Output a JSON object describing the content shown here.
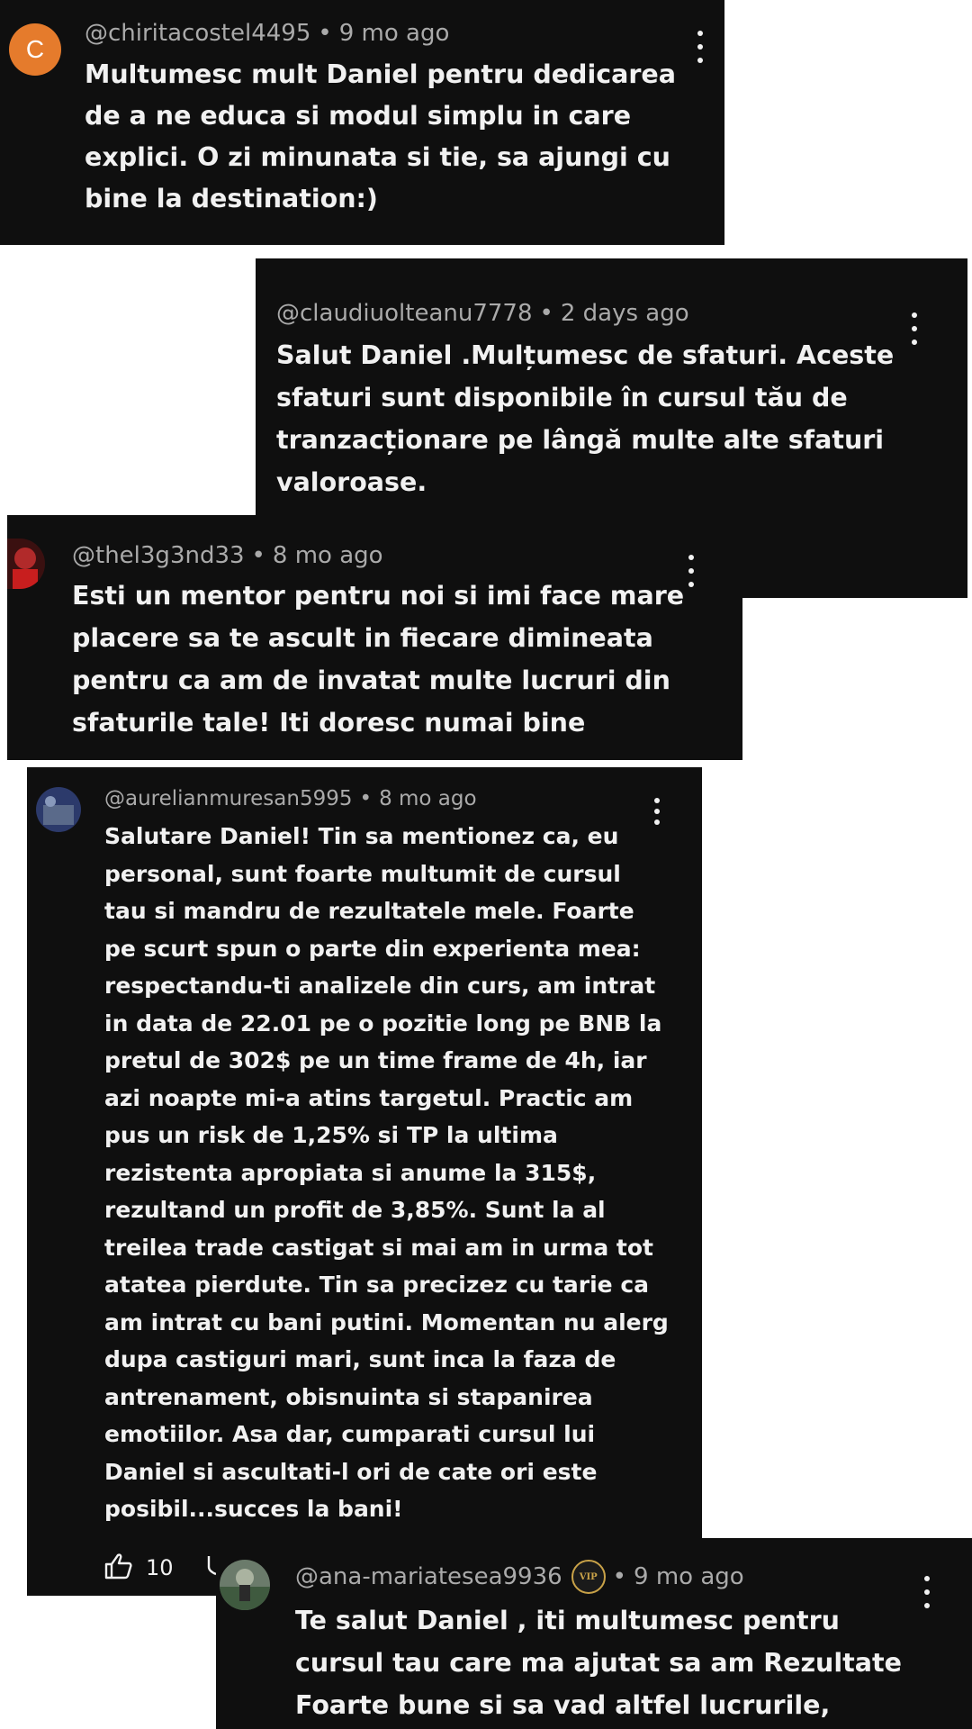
{
  "comments": [
    {
      "avatar_letter": "C",
      "avatar_color": "#e57b2c",
      "author": "@chiritacostel4495",
      "separator": "•",
      "time": "9 mo ago",
      "text": "Multumesc mult Daniel pentru dedicarea\nde a ne educa si modul simplu in care\nexplici. O zi minunata si tie, sa ajungi cu\nbine la destination:)"
    },
    {
      "author": "@claudiuolteanu7778",
      "separator": "•",
      "time": "2 days ago",
      "text": "Salut Daniel .Mulțumesc de sfaturi. Aceste\nsfaturi sunt disponibile în cursul tău de\ntranzacționare pe lângă multe alte sfaturi\nvaloroase."
    },
    {
      "author": "@thel3g3nd33",
      "separator": "•",
      "time": "8 mo ago",
      "text": "Esti un mentor pentru noi si imi face mare\nplacere sa te ascult in fiecare dimineata\npentru ca am de invatat multe lucruri din\nsfaturile tale! Iti doresc numai bine"
    },
    {
      "author": "@aurelianmuresan5995",
      "separator": "•",
      "time": "8 mo ago",
      "text": "Salutare Daniel! Tin sa mentionez ca, eu\npersonal, sunt foarte multumit de cursul\ntau si mandru de rezultatele mele. Foarte\npe scurt spun o parte din experienta mea:\nrespectandu-ti analizele din curs, am intrat\nin data de 22.01 pe o pozitie long pe BNB la\npretul de 302$ pe un time frame de 4h, iar\nazi noapte mi-a atins targetul. Practic am\npus un risk de 1,25% si TP la ultima\nrezistenta apropiata si anume la 315$,\nrezultand un profit de 3,85%. Sunt la al\ntreilea trade castigat si mai am in urma tot\natatea pierdute. Tin sa precizez cu tarie ca\nam intrat cu bani putini. Momentan nu alerg\ndupa castiguri mari, sunt inca la faza de\nantrenament, obisnuinta si stapanirea\nemotiilor. Asa dar, cumparati cursul lui\nDaniel si ascultati-l ori de cate ori este\nposibil...succes la bani!",
      "like_count": "10"
    },
    {
      "author": "@ana-mariatesea9936",
      "badge": "VIP",
      "separator": "•",
      "time": "9 mo ago",
      "text": "Te salut Daniel ,  iti multumesc pentru\ncursul tau care ma ajutat sa am Rezultate\nFoarte bune si sa vad altfel lucrurile,"
    }
  ],
  "icons": {
    "kebab": "more-vert-icon",
    "like": "thumb-up-icon",
    "dislike": "thumb-down-icon"
  }
}
